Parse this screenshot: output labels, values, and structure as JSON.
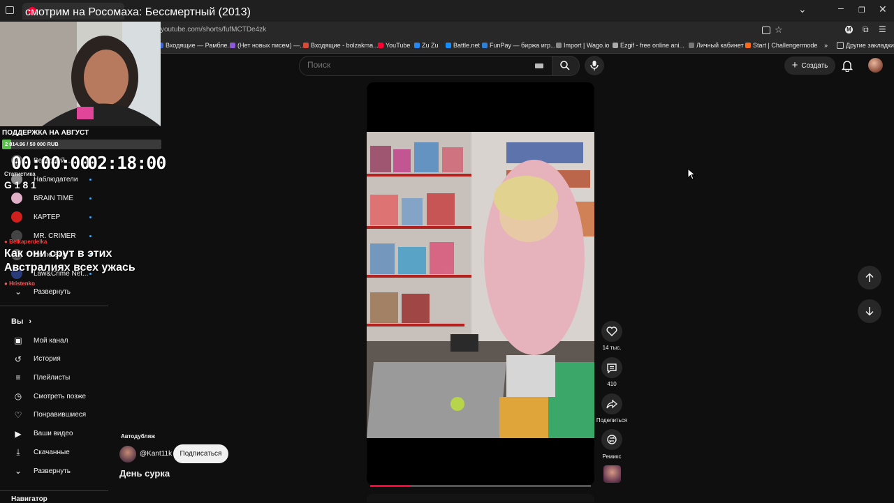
{
  "stream_overlay": {
    "title": "смотрим на Росомаха: Бессмертный (2013)",
    "support_title": "ПОДДЕРЖКА НА АВГУСТ",
    "support_amount": "2 814.96 / 50 000 RUB",
    "support_progress": 0.056,
    "timer_left": "00:00:00",
    "timer_right": "02:18:00",
    "stats_label": "Статистика",
    "stats_values": "G 1   8   1",
    "chat_user_1": "Belkaperdelka",
    "chat_message": "Как они срут в этих Австралиях всех ужась",
    "chat_user_2": "Hristenko",
    "colors": {
      "user1": "#ff3b3b",
      "user2": "#ff5a5a",
      "support_fill": "#58c24a"
    }
  },
  "browser": {
    "url": "youtube.com/shorts/fufMCTDe4zk",
    "bookmarks": [
      {
        "label": "Входящие — Рамбле...",
        "color": "#3a66d8"
      },
      {
        "label": "(Нет новых писем) —...",
        "color": "#8c5ad8"
      },
      {
        "label": "Входящие - bolzakma...",
        "color": "#d84a3a"
      },
      {
        "label": "YouTube",
        "color": "#ff0033"
      },
      {
        "label": "Zu Zu",
        "color": "#2787f5"
      },
      {
        "label": "Battle.net",
        "color": "#148eff"
      },
      {
        "label": "FunPay — биржа игр...",
        "color": "#2d7fd8"
      },
      {
        "label": "Import | Wago.io",
        "color": "#888888"
      },
      {
        "label": "Ezgif - free online ani...",
        "color": "#aaaaaa"
      },
      {
        "label": "Личный кабинет",
        "color": "#777777"
      },
      {
        "label": "Start | Challengermode",
        "color": "#ff6a1a"
      }
    ],
    "bookmarks_other": "Другие закладки"
  },
  "header": {
    "search_placeholder": "Поиск",
    "create_label": "Создать"
  },
  "sidebar": {
    "subscriptions": [
      {
        "label": "Вечерний...",
        "color": "#6a6a6a"
      },
      {
        "label": "Наблюдатели",
        "color": "#8a8a8a"
      },
      {
        "label": "BRAIN TIME",
        "color": "#e0b0c8"
      },
      {
        "label": "КАРТЕР",
        "color": "#d0201e"
      },
      {
        "label": "MR. CRIMER",
        "color": "#444444"
      },
      {
        "label": "Crime Bay",
        "color": "#5a5a5a"
      },
      {
        "label": "Law&Crime Net...",
        "color": "#2a3b7a"
      }
    ],
    "expand_subs": "Развернуть",
    "you_title": "Вы",
    "you_items": [
      {
        "label": "Мой канал",
        "icon": "channel-icon"
      },
      {
        "label": "История",
        "icon": "history-icon"
      },
      {
        "label": "Плейлисты",
        "icon": "playlists-icon"
      },
      {
        "label": "Смотреть позже",
        "icon": "watch-later-icon"
      },
      {
        "label": "Понравившиеся",
        "icon": "like-icon"
      },
      {
        "label": "Ваши видео",
        "icon": "your-videos-icon"
      },
      {
        "label": "Скачанные",
        "icon": "download-icon"
      }
    ],
    "expand_you": "Развернуть",
    "navigator_title": "Навигатор"
  },
  "short": {
    "autodub_label": "Автодубляж",
    "channel_handle": "@Kant11k",
    "subscribe_label": "Подписаться",
    "title": "День сурка",
    "likes": "14 тыс.",
    "comments": "410",
    "share_label": "Поделиться",
    "remix_label": "Ремикс",
    "progress": 0.18
  }
}
